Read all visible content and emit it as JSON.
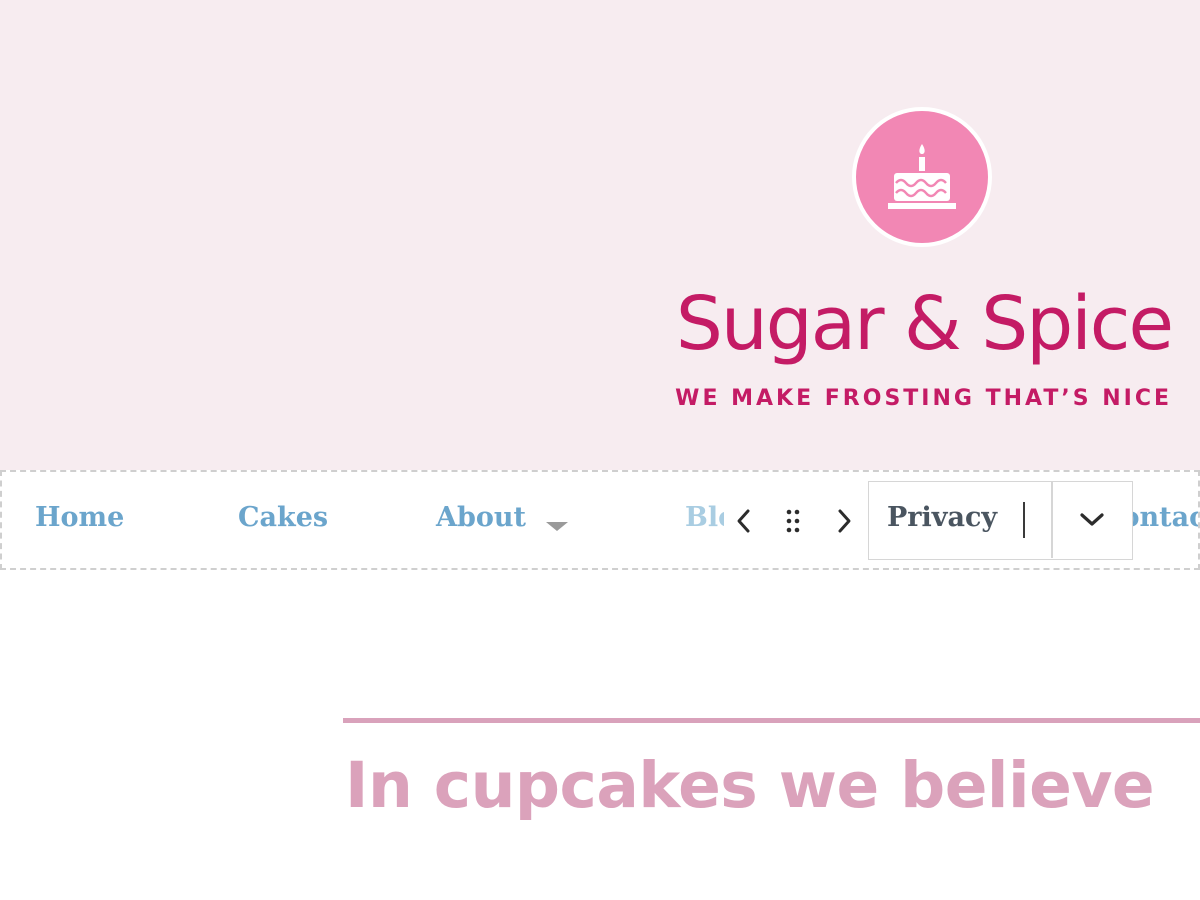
{
  "header": {
    "logo_icon": "birthday-cake-icon",
    "site_title": "Sugar & Spice",
    "tagline": "WE MAKE FROSTING THAT’S NICE",
    "background_color": "#f7ecf0",
    "brand_color": "#c41b65",
    "logo_color": "#f287b4"
  },
  "nav": {
    "items": [
      {
        "label": "Home"
      },
      {
        "label": "Cakes"
      },
      {
        "label": "About",
        "has_submenu": true
      },
      {
        "label": "Blog"
      },
      {
        "label": "Contact"
      }
    ],
    "link_color": "#6ba5cc"
  },
  "block_toolbar": {
    "prev_icon": "chevron-left-icon",
    "drag_icon": "drag-handle-icon",
    "next_icon": "chevron-right-icon",
    "editing_value": "Privacy",
    "toggle_icon": "chevron-down-icon"
  },
  "content": {
    "heading": "In cupcakes we believe",
    "heading_color": "#dba2bb",
    "separator_color": "#d9a2bb"
  }
}
